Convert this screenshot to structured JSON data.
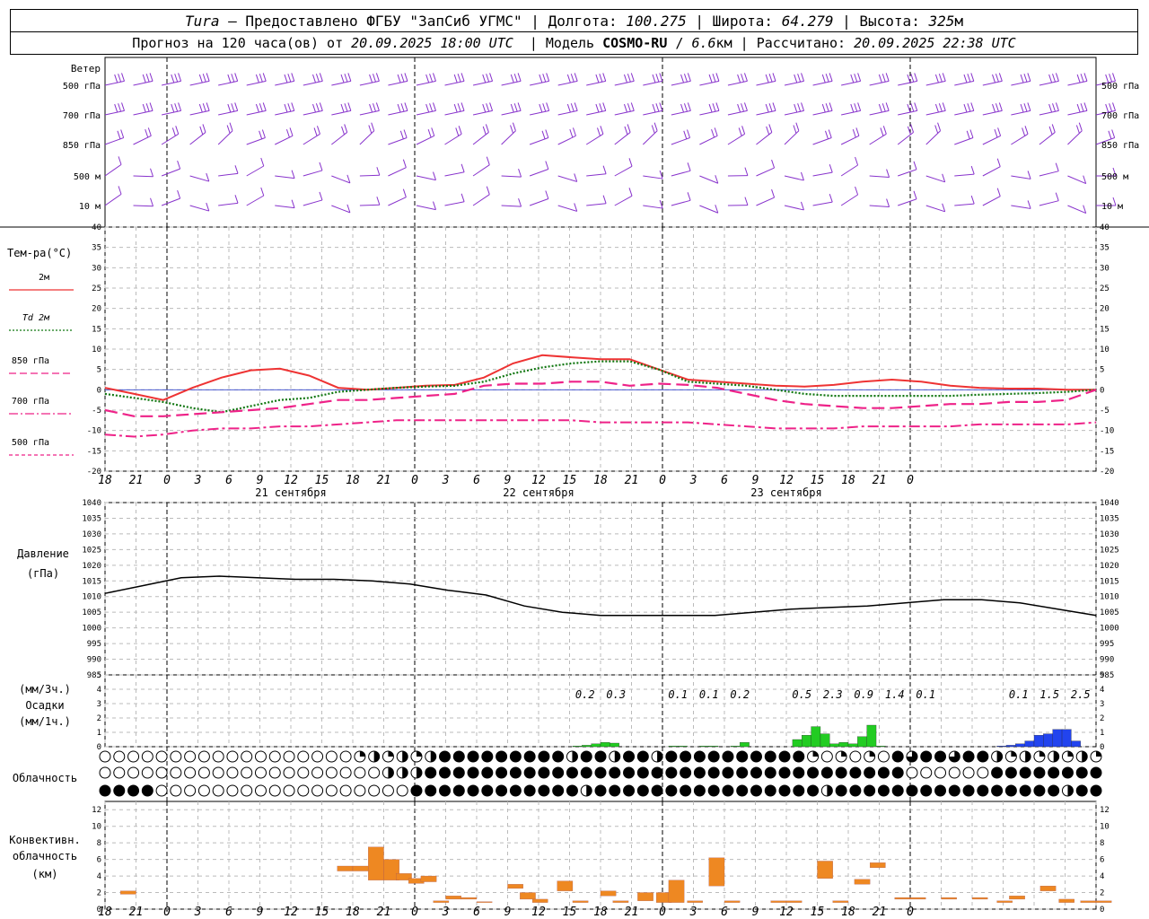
{
  "header": {
    "station": "Tura",
    "provider": "Предоставлено ФГБУ \"ЗапСиб УГМС\"",
    "lon_label": "Долгота:",
    "lon": "100.275",
    "lat_label": "Широта:",
    "lat": "64.279",
    "alt_label": "Высота:",
    "alt": "325",
    "alt_unit": "м",
    "forecast_prefix": "Прогноз на 120 часа(ов) от",
    "forecast_start": "20.09.2025 18:00 UTC",
    "model_label": "Модель",
    "model": "COSMO-RU",
    "resolution": "6.6",
    "resolution_unit": "км",
    "calc_label": "Рассчитано:",
    "calc_time": "20.09.2025 22:38 UTC"
  },
  "time_axis": {
    "tick_labels": [
      "18",
      "21",
      "0",
      "3",
      "6",
      "9",
      "12",
      "15",
      "18",
      "21",
      "0",
      "3",
      "6",
      "9",
      "12",
      "15",
      "18",
      "21",
      "0",
      "3",
      "6",
      "9",
      "12",
      "15",
      "18",
      "21",
      "0"
    ],
    "days": [
      "21 сентября",
      "22 сентября",
      "23 сентября"
    ]
  },
  "colors": {
    "t2m": "#ee3333",
    "td2m": "#117711",
    "t850": "#ee2288",
    "t700": "#ee2288",
    "t500": "#ee2288",
    "wind": "#8833cc",
    "precip_rain": "#22cc22",
    "precip_snow": "#2244ee",
    "convective": "#ee8822"
  },
  "panels": {
    "wind": {
      "title": "Ветер",
      "levels": [
        "500 гПа",
        "700 гПа",
        "850 гПа",
        "500 м",
        "10  м"
      ]
    },
    "temperature": {
      "title": "Тем-ра(°C)",
      "legend": [
        {
          "label": "2м",
          "color": "#ee3333",
          "style": "solid"
        },
        {
          "label": "Td  2м",
          "color": "#117711",
          "style": "dotted"
        },
        {
          "label": "850 гПа",
          "color": "#ee2288",
          "style": "dashed"
        },
        {
          "label": "700 гПа",
          "color": "#ee2288",
          "style": "dashdot"
        },
        {
          "label": "500 гПа",
          "color": "#ee2288",
          "style": "finedash"
        }
      ]
    },
    "pressure": {
      "title": "Давление",
      "unit": "(гПа)"
    },
    "precip": {
      "unit1": "(мм/3ч.)",
      "title": "Осадки",
      "unit2": "(мм/1ч.)"
    },
    "clouds": {
      "title": "Облачность"
    },
    "convective": {
      "title1": "Конвективн.",
      "title2": "облачность",
      "unit": "(км)"
    }
  },
  "chart_data": [
    {
      "type": "line",
      "name": "temperature",
      "x": [
        0,
        1,
        2,
        3,
        4,
        5,
        6,
        7,
        8,
        9,
        10,
        11,
        12,
        13,
        14,
        15,
        16,
        17,
        18,
        19,
        20,
        21,
        22,
        23,
        24,
        25,
        26,
        27,
        28,
        29,
        30,
        31,
        32,
        33,
        34,
        35,
        36,
        37,
        38,
        39,
        40
      ],
      "x_units": "3-hour steps from 20.09.2025 18:00 UTC",
      "ylim": [
        -20,
        40
      ],
      "yticks": [
        -20,
        -15,
        -10,
        -5,
        0,
        5,
        10,
        15,
        20,
        25,
        30,
        35,
        40
      ],
      "series": [
        {
          "name": "2м",
          "values": [
            0.5,
            -1,
            -2.5,
            0.5,
            3,
            4.8,
            5.2,
            3.5,
            0.5,
            0,
            0.5,
            1,
            1.2,
            3,
            6.5,
            8.5,
            8,
            7.5,
            7.5,
            5,
            2.5,
            2,
            1.5,
            1,
            0.8,
            1.2,
            2,
            2.5,
            2,
            1,
            0.5,
            0.3,
            0.3,
            0,
            0
          ]
        },
        {
          "name": "Td  2м",
          "values": [
            -1,
            -2,
            -3,
            -4.5,
            -5.5,
            -4,
            -2.5,
            -2,
            -0.5,
            0,
            0.5,
            0.8,
            1,
            2,
            4,
            5.5,
            6.5,
            7,
            7,
            5,
            2,
            1.5,
            1,
            0,
            -1,
            -1.5,
            -1.5,
            -1.5,
            -1.5,
            -1.5,
            -1.2,
            -1,
            -0.8,
            -0.5,
            0
          ]
        },
        {
          "name": "850 гПа",
          "values": [
            -5,
            -6.5,
            -6.5,
            -6,
            -5.5,
            -5,
            -4.5,
            -3.5,
            -2.5,
            -2.5,
            -2,
            -1.5,
            -1,
            1,
            1.5,
            1.5,
            2,
            2,
            1,
            1.5,
            1.2,
            0.5,
            -1,
            -2.5,
            -3.5,
            -4,
            -4.5,
            -4.5,
            -4,
            -3.5,
            -3.5,
            -3,
            -3,
            -2.5,
            0
          ]
        },
        {
          "name": "700 гПа",
          "values": [
            -11,
            -11.5,
            -11,
            -10,
            -9.5,
            -9.5,
            -9,
            -9,
            -8.5,
            -8,
            -7.5,
            -7.5,
            -7.5,
            -7.5,
            -7.5,
            -7.5,
            -7.5,
            -8,
            -8,
            -8,
            -8,
            -8.5,
            -9,
            -9.5,
            -9.5,
            -9.5,
            -9,
            -9,
            -9,
            -9,
            -8.5,
            -8.5,
            -8.5,
            -8.5,
            -8
          ]
        }
      ]
    },
    {
      "type": "line",
      "name": "pressure",
      "x": [
        0,
        1,
        2,
        3,
        4,
        5,
        6,
        7,
        8,
        9,
        10,
        11,
        12,
        13,
        14,
        15,
        16,
        17,
        18,
        19,
        20,
        21,
        22,
        23,
        24,
        25,
        26,
        27,
        28,
        29,
        30,
        31,
        32,
        33,
        34,
        35,
        36,
        37,
        38,
        39,
        40
      ],
      "ylim": [
        985,
        1040
      ],
      "yticks": [
        985,
        990,
        995,
        1000,
        1005,
        1010,
        1015,
        1020,
        1025,
        1030,
        1035,
        1040
      ],
      "values": [
        1011,
        1013.5,
        1016,
        1016.5,
        1016,
        1015.5,
        1015.5,
        1015,
        1014,
        1012,
        1010.5,
        1007,
        1005,
        1004,
        1004,
        1004,
        1004,
        1005,
        1006,
        1006.5,
        1007,
        1008,
        1009,
        1009,
        1008,
        1006,
        1004
      ]
    },
    {
      "type": "bar",
      "name": "precipitation",
      "ylim": [
        0,
        5
      ],
      "yticks": [
        0,
        1,
        2,
        3,
        4,
        5
      ],
      "totals_3h": [
        {
          "x": 15.5,
          "label": "0.2"
        },
        {
          "x": 16.5,
          "label": "0.3"
        },
        {
          "x": 18.5,
          "label": "0.1"
        },
        {
          "x": 19.5,
          "label": "0.1"
        },
        {
          "x": 20.5,
          "label": "0.2"
        },
        {
          "x": 22.5,
          "label": "0.5"
        },
        {
          "x": 23.5,
          "label": "2.3"
        },
        {
          "x": 24.5,
          "label": "0.9"
        },
        {
          "x": 25.5,
          "label": "1.4"
        },
        {
          "x": 26.5,
          "label": "0.1"
        },
        {
          "x": 29.5,
          "label": "0.1"
        },
        {
          "x": 30.5,
          "label": "1.5"
        },
        {
          "x": 31.5,
          "label": "2.5"
        }
      ],
      "series": [
        {
          "name": "rain",
          "bars": [
            [
              15.1,
              0.05
            ],
            [
              15.4,
              0.1
            ],
            [
              15.7,
              0.2
            ],
            [
              16.0,
              0.3
            ],
            [
              16.3,
              0.25
            ],
            [
              18.2,
              0.05
            ],
            [
              18.5,
              0.05
            ],
            [
              19.2,
              0.05
            ],
            [
              19.5,
              0.05
            ],
            [
              20.2,
              0.05
            ],
            [
              20.5,
              0.3
            ],
            [
              22.2,
              0.5
            ],
            [
              22.5,
              0.8
            ],
            [
              22.8,
              1.4
            ],
            [
              23.1,
              0.9
            ],
            [
              23.4,
              0.2
            ],
            [
              23.7,
              0.3
            ],
            [
              24.0,
              0.2
            ],
            [
              24.3,
              0.7
            ],
            [
              24.6,
              1.5
            ],
            [
              24.9,
              0.05
            ]
          ]
        },
        {
          "name": "snow",
          "bars": [
            [
              28.8,
              0.05
            ],
            [
              29.1,
              0.1
            ],
            [
              29.4,
              0.2
            ],
            [
              29.7,
              0.4
            ],
            [
              30.0,
              0.8
            ],
            [
              30.3,
              0.9
            ],
            [
              30.6,
              1.2
            ],
            [
              30.9,
              1.2
            ],
            [
              31.2,
              0.4
            ]
          ]
        }
      ]
    },
    {
      "type": "bar",
      "name": "convective_cloud",
      "ylim": [
        0,
        13
      ],
      "yticks": [
        0,
        2,
        4,
        6,
        8,
        10,
        12
      ],
      "bars": [
        [
          0.5,
          1.8,
          2.2
        ],
        [
          7.5,
          4.6,
          5.2
        ],
        [
          8.0,
          4.6,
          5.2
        ],
        [
          8.5,
          3.5,
          7.5
        ],
        [
          9.0,
          3.5,
          6
        ],
        [
          9.4,
          3.5,
          4.3
        ],
        [
          9.8,
          3.1,
          3.7
        ],
        [
          10.2,
          3.3,
          4.0
        ],
        [
          10.6,
          0.8,
          1.0
        ],
        [
          11.0,
          1.2,
          1.6
        ],
        [
          11.5,
          1.2,
          1.4
        ],
        [
          12.0,
          0.8,
          0.9
        ],
        [
          13.0,
          2.5,
          3.0
        ],
        [
          13.4,
          1.2,
          2.0
        ],
        [
          13.8,
          0.8,
          1.2
        ],
        [
          14.6,
          2.2,
          3.4
        ],
        [
          15.1,
          0.8,
          1.0
        ],
        [
          16.0,
          1.6,
          2.2
        ],
        [
          16.4,
          0.8,
          1.0
        ],
        [
          17.2,
          1.0,
          2.0
        ],
        [
          17.8,
          0.8,
          2.0
        ],
        [
          18.2,
          0.8,
          3.5
        ],
        [
          18.8,
          0.8,
          1.0
        ],
        [
          19.5,
          2.8,
          6.2
        ],
        [
          20.0,
          0.8,
          1.0
        ],
        [
          21.5,
          0.8,
          1.0
        ],
        [
          22.0,
          0.8,
          1.0
        ],
        [
          23.0,
          3.7,
          5.8
        ],
        [
          23.5,
          0.8,
          1.0
        ],
        [
          24.2,
          3.0,
          3.6
        ],
        [
          24.7,
          5.0,
          5.6
        ],
        [
          25.5,
          1.2,
          1.4
        ],
        [
          26.0,
          1.2,
          1.4
        ],
        [
          27.0,
          1.2,
          1.4
        ],
        [
          28.0,
          1.2,
          1.4
        ],
        [
          28.8,
          0.8,
          1.0
        ],
        [
          29.2,
          1.2,
          1.6
        ],
        [
          30.2,
          2.2,
          2.8
        ],
        [
          30.8,
          0.8,
          1.2
        ],
        [
          31.5,
          0.8,
          1.0
        ],
        [
          32.0,
          0.8,
          1.0
        ]
      ]
    }
  ]
}
